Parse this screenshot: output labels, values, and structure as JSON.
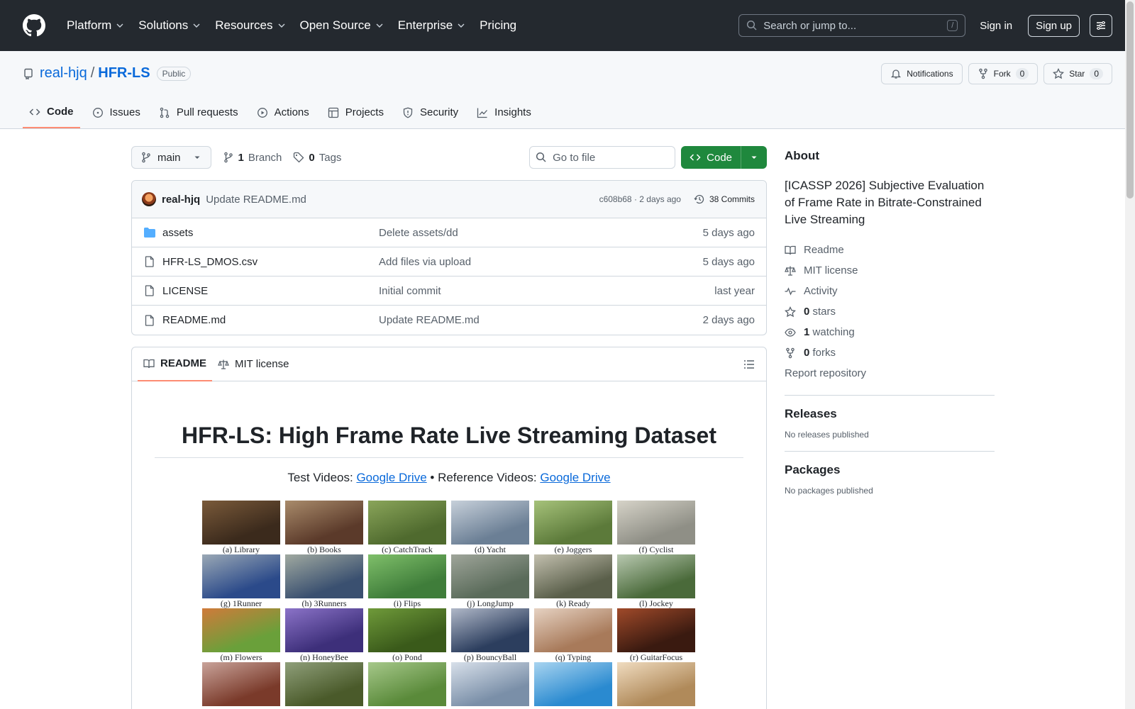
{
  "header": {
    "nav": [
      "Platform",
      "Solutions",
      "Resources",
      "Open Source",
      "Enterprise",
      "Pricing"
    ],
    "search_placeholder": "Search or jump to...",
    "search_shortcut": "/",
    "signin": "Sign in",
    "signup": "Sign up"
  },
  "repo": {
    "owner": "real-hjq",
    "separator": "/",
    "name": "HFR-LS",
    "visibility": "Public",
    "notifications": "Notifications",
    "fork_label": "Fork",
    "fork_count": "0",
    "star_label": "Star",
    "star_count": "0"
  },
  "tabs": [
    "Code",
    "Issues",
    "Pull requests",
    "Actions",
    "Projects",
    "Security",
    "Insights"
  ],
  "toolbar": {
    "branch": "main",
    "branch_count": "1",
    "branch_label": "Branch",
    "tag_count": "0",
    "tag_label": "Tags",
    "goto_placeholder": "Go to file",
    "code_label": "Code"
  },
  "commit": {
    "author": "real-hjq",
    "message": "Update README.md",
    "hash_time": "c608b68 · 2 days ago",
    "commits_label": "38 Commits"
  },
  "files": [
    {
      "name": "assets",
      "type": "folder",
      "commit": "Delete assets/dd",
      "date": "5 days ago"
    },
    {
      "name": "HFR-LS_DMOS.csv",
      "type": "file",
      "commit": "Add files via upload",
      "date": "5 days ago"
    },
    {
      "name": "LICENSE",
      "type": "file",
      "commit": "Initial commit",
      "date": "last year"
    },
    {
      "name": "README.md",
      "type": "file",
      "commit": "Update README.md",
      "date": "2 days ago"
    }
  ],
  "readme": {
    "tab_readme": "README",
    "tab_license": "MIT license",
    "title": "HFR-LS: High Frame Rate Live Streaming Dataset",
    "test_label": "Test Videos: ",
    "test_link": "Google Drive",
    "bullet": " • ",
    "ref_label": "Reference Videos: ",
    "ref_link": "Google Drive",
    "thumbnails": [
      "(a) Library",
      "(b) Books",
      "(c) CatchTrack",
      "(d) Yacht",
      "(e) Joggers",
      "(f) Cyclist",
      "(g) 1Runner",
      "(h) 3Runners",
      "(i) Flips",
      "(j) LongJump",
      "(k) Ready",
      "(l) Jockey",
      "(m) Flowers",
      "(n) HoneyBee",
      "(o) Pond",
      "(p) BouncyBall",
      "(q) Typing",
      "(r) GuitarFocus",
      "",
      "",
      "",
      "",
      "",
      ""
    ]
  },
  "about": {
    "heading": "About",
    "description": "[ICASSP 2026] Subjective Evaluation of Frame Rate in Bitrate-Constrained Live Streaming",
    "readme": "Readme",
    "license": "MIT license",
    "activity": "Activity",
    "stars_count": "0",
    "stars_label": "stars",
    "watching_count": "1",
    "watching_label": "watching",
    "forks_count": "0",
    "forks_label": "forks",
    "report": "Report repository"
  },
  "releases": {
    "heading": "Releases",
    "note": "No releases published"
  },
  "packages": {
    "heading": "Packages",
    "note": "No packages published"
  },
  "colors": {
    "header_bg": "#24292f",
    "link": "#0969da",
    "code_button": "#1f883d",
    "active_tab": "#fd8c73"
  }
}
